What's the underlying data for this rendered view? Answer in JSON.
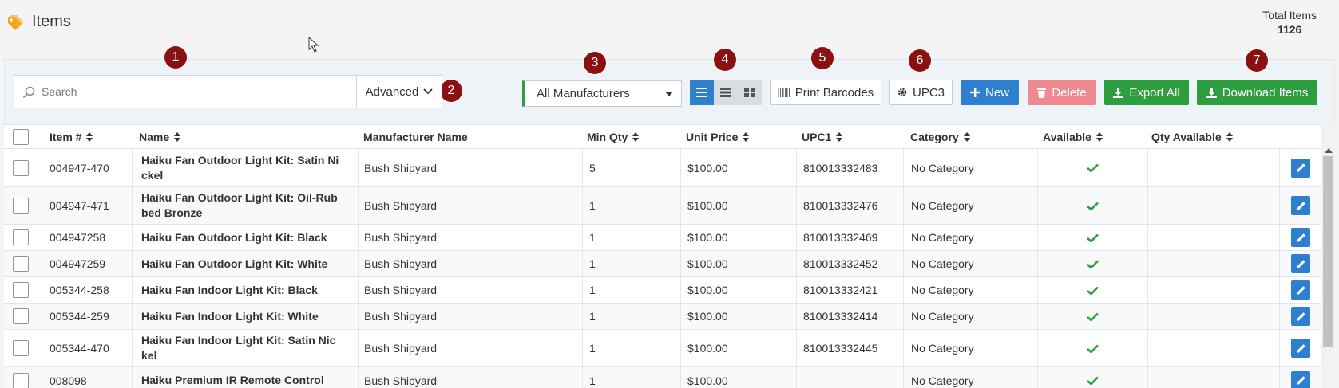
{
  "header": {
    "title": "Items",
    "total_label": "Total Items",
    "total_value": "1126"
  },
  "markers": [
    "1",
    "2",
    "3",
    "4",
    "5",
    "6",
    "7"
  ],
  "toolbar": {
    "search_placeholder": "Search",
    "advanced_label": "Advanced",
    "manufacturer_selected": "All Manufacturers",
    "print_barcodes_label": "Print Barcodes",
    "upc_label": "UPC3",
    "new_label": "New",
    "delete_label": "Delete",
    "export_all_label": "Export All",
    "download_items_label": "Download Items"
  },
  "table": {
    "columns": {
      "item_no": "Item #",
      "name": "Name",
      "manufacturer": "Manufacturer Name",
      "min_qty": "Min Qty",
      "unit_price": "Unit Price",
      "upc1": "UPC1",
      "category": "Category",
      "available": "Available",
      "qty_available": "Qty Available"
    },
    "rows": [
      {
        "item_no": "004947-470",
        "name": "Haiku Fan Outdoor Light Kit: Satin Ni ckel",
        "manufacturer": "Bush Shipyard",
        "min_qty": "5",
        "unit_price": "$100.00",
        "upc1": "810013332483",
        "category": "No Category",
        "qty_available": ""
      },
      {
        "item_no": "004947-471",
        "name": "Haiku Fan Outdoor Light Kit: Oil-Rub bed Bronze",
        "manufacturer": "Bush Shipyard",
        "min_qty": "1",
        "unit_price": "$100.00",
        "upc1": "810013332476",
        "category": "No Category",
        "qty_available": ""
      },
      {
        "item_no": "004947258",
        "name": "Haiku Fan Outdoor Light Kit: Black",
        "manufacturer": "Bush Shipyard",
        "min_qty": "1",
        "unit_price": "$100.00",
        "upc1": "810013332469",
        "category": "No Category",
        "qty_available": ""
      },
      {
        "item_no": "004947259",
        "name": "Haiku Fan Outdoor Light Kit: White",
        "manufacturer": "Bush Shipyard",
        "min_qty": "1",
        "unit_price": "$100.00",
        "upc1": "810013332452",
        "category": "No Category",
        "qty_available": ""
      },
      {
        "item_no": "005344-258",
        "name": "Haiku Fan Indoor Light Kit: Black",
        "manufacturer": "Bush Shipyard",
        "min_qty": "1",
        "unit_price": "$100.00",
        "upc1": "810013332421",
        "category": "No Category",
        "qty_available": ""
      },
      {
        "item_no": "005344-259",
        "name": "Haiku Fan Indoor Light Kit: White",
        "manufacturer": "Bush Shipyard",
        "min_qty": "1",
        "unit_price": "$100.00",
        "upc1": "810013332414",
        "category": "No Category",
        "qty_available": ""
      },
      {
        "item_no": "005344-470",
        "name": "Haiku Fan Indoor Light Kit: Satin Nic kel",
        "manufacturer": "Bush Shipyard",
        "min_qty": "1",
        "unit_price": "$100.00",
        "upc1": "810013332445",
        "category": "No Category",
        "qty_available": ""
      },
      {
        "item_no": "008098",
        "name": "Haiku Premium IR Remote Control",
        "manufacturer": "Bush Shipyard",
        "min_qty": "1",
        "unit_price": "$100.00",
        "upc1": "",
        "category": "No Category",
        "qty_available": ""
      }
    ]
  },
  "colors": {
    "accent_blue": "#2f7fd0",
    "accent_green": "#2e9e3e",
    "danger_pink": "#f08a91",
    "marker_red": "#8b1010",
    "tag_orange": "#f5a31a",
    "check_green": "#2e9e3e"
  },
  "icons": [
    "tag-icon",
    "search-icon",
    "chevron-down-icon",
    "list-view-icon",
    "detail-view-icon",
    "grid-view-icon",
    "barcode-icon",
    "gear-icon",
    "plus-icon",
    "trash-icon",
    "download-icon",
    "check-icon",
    "pencil-icon",
    "sort-icon"
  ]
}
